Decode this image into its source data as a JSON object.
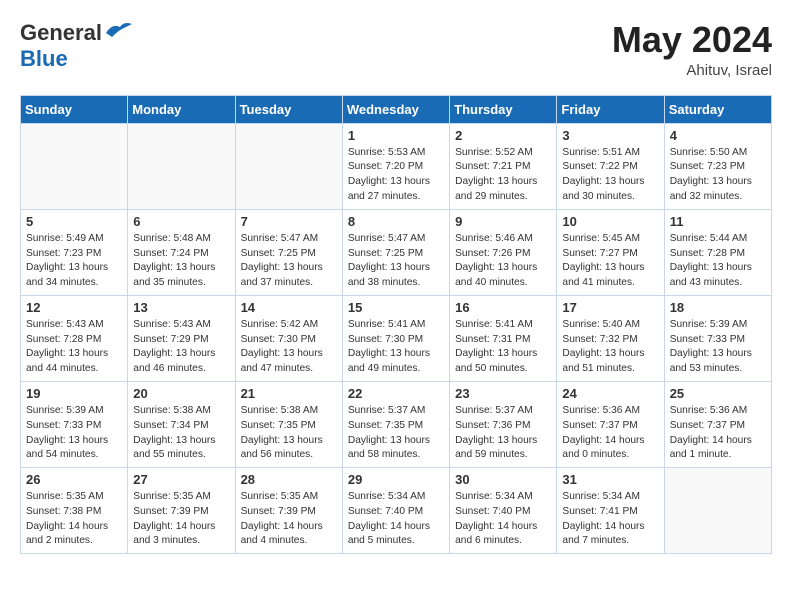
{
  "header": {
    "logo_general": "General",
    "logo_blue": "Blue",
    "month": "May 2024",
    "location": "Ahituv, Israel"
  },
  "weekdays": [
    "Sunday",
    "Monday",
    "Tuesday",
    "Wednesday",
    "Thursday",
    "Friday",
    "Saturday"
  ],
  "weeks": [
    [
      {
        "day": "",
        "info": ""
      },
      {
        "day": "",
        "info": ""
      },
      {
        "day": "",
        "info": ""
      },
      {
        "day": "1",
        "info": "Sunrise: 5:53 AM\nSunset: 7:20 PM\nDaylight: 13 hours\nand 27 minutes."
      },
      {
        "day": "2",
        "info": "Sunrise: 5:52 AM\nSunset: 7:21 PM\nDaylight: 13 hours\nand 29 minutes."
      },
      {
        "day": "3",
        "info": "Sunrise: 5:51 AM\nSunset: 7:22 PM\nDaylight: 13 hours\nand 30 minutes."
      },
      {
        "day": "4",
        "info": "Sunrise: 5:50 AM\nSunset: 7:23 PM\nDaylight: 13 hours\nand 32 minutes."
      }
    ],
    [
      {
        "day": "5",
        "info": "Sunrise: 5:49 AM\nSunset: 7:23 PM\nDaylight: 13 hours\nand 34 minutes."
      },
      {
        "day": "6",
        "info": "Sunrise: 5:48 AM\nSunset: 7:24 PM\nDaylight: 13 hours\nand 35 minutes."
      },
      {
        "day": "7",
        "info": "Sunrise: 5:47 AM\nSunset: 7:25 PM\nDaylight: 13 hours\nand 37 minutes."
      },
      {
        "day": "8",
        "info": "Sunrise: 5:47 AM\nSunset: 7:25 PM\nDaylight: 13 hours\nand 38 minutes."
      },
      {
        "day": "9",
        "info": "Sunrise: 5:46 AM\nSunset: 7:26 PM\nDaylight: 13 hours\nand 40 minutes."
      },
      {
        "day": "10",
        "info": "Sunrise: 5:45 AM\nSunset: 7:27 PM\nDaylight: 13 hours\nand 41 minutes."
      },
      {
        "day": "11",
        "info": "Sunrise: 5:44 AM\nSunset: 7:28 PM\nDaylight: 13 hours\nand 43 minutes."
      }
    ],
    [
      {
        "day": "12",
        "info": "Sunrise: 5:43 AM\nSunset: 7:28 PM\nDaylight: 13 hours\nand 44 minutes."
      },
      {
        "day": "13",
        "info": "Sunrise: 5:43 AM\nSunset: 7:29 PM\nDaylight: 13 hours\nand 46 minutes."
      },
      {
        "day": "14",
        "info": "Sunrise: 5:42 AM\nSunset: 7:30 PM\nDaylight: 13 hours\nand 47 minutes."
      },
      {
        "day": "15",
        "info": "Sunrise: 5:41 AM\nSunset: 7:30 PM\nDaylight: 13 hours\nand 49 minutes."
      },
      {
        "day": "16",
        "info": "Sunrise: 5:41 AM\nSunset: 7:31 PM\nDaylight: 13 hours\nand 50 minutes."
      },
      {
        "day": "17",
        "info": "Sunrise: 5:40 AM\nSunset: 7:32 PM\nDaylight: 13 hours\nand 51 minutes."
      },
      {
        "day": "18",
        "info": "Sunrise: 5:39 AM\nSunset: 7:33 PM\nDaylight: 13 hours\nand 53 minutes."
      }
    ],
    [
      {
        "day": "19",
        "info": "Sunrise: 5:39 AM\nSunset: 7:33 PM\nDaylight: 13 hours\nand 54 minutes."
      },
      {
        "day": "20",
        "info": "Sunrise: 5:38 AM\nSunset: 7:34 PM\nDaylight: 13 hours\nand 55 minutes."
      },
      {
        "day": "21",
        "info": "Sunrise: 5:38 AM\nSunset: 7:35 PM\nDaylight: 13 hours\nand 56 minutes."
      },
      {
        "day": "22",
        "info": "Sunrise: 5:37 AM\nSunset: 7:35 PM\nDaylight: 13 hours\nand 58 minutes."
      },
      {
        "day": "23",
        "info": "Sunrise: 5:37 AM\nSunset: 7:36 PM\nDaylight: 13 hours\nand 59 minutes."
      },
      {
        "day": "24",
        "info": "Sunrise: 5:36 AM\nSunset: 7:37 PM\nDaylight: 14 hours\nand 0 minutes."
      },
      {
        "day": "25",
        "info": "Sunrise: 5:36 AM\nSunset: 7:37 PM\nDaylight: 14 hours\nand 1 minute."
      }
    ],
    [
      {
        "day": "26",
        "info": "Sunrise: 5:35 AM\nSunset: 7:38 PM\nDaylight: 14 hours\nand 2 minutes."
      },
      {
        "day": "27",
        "info": "Sunrise: 5:35 AM\nSunset: 7:39 PM\nDaylight: 14 hours\nand 3 minutes."
      },
      {
        "day": "28",
        "info": "Sunrise: 5:35 AM\nSunset: 7:39 PM\nDaylight: 14 hours\nand 4 minutes."
      },
      {
        "day": "29",
        "info": "Sunrise: 5:34 AM\nSunset: 7:40 PM\nDaylight: 14 hours\nand 5 minutes."
      },
      {
        "day": "30",
        "info": "Sunrise: 5:34 AM\nSunset: 7:40 PM\nDaylight: 14 hours\nand 6 minutes."
      },
      {
        "day": "31",
        "info": "Sunrise: 5:34 AM\nSunset: 7:41 PM\nDaylight: 14 hours\nand 7 minutes."
      },
      {
        "day": "",
        "info": ""
      }
    ]
  ]
}
